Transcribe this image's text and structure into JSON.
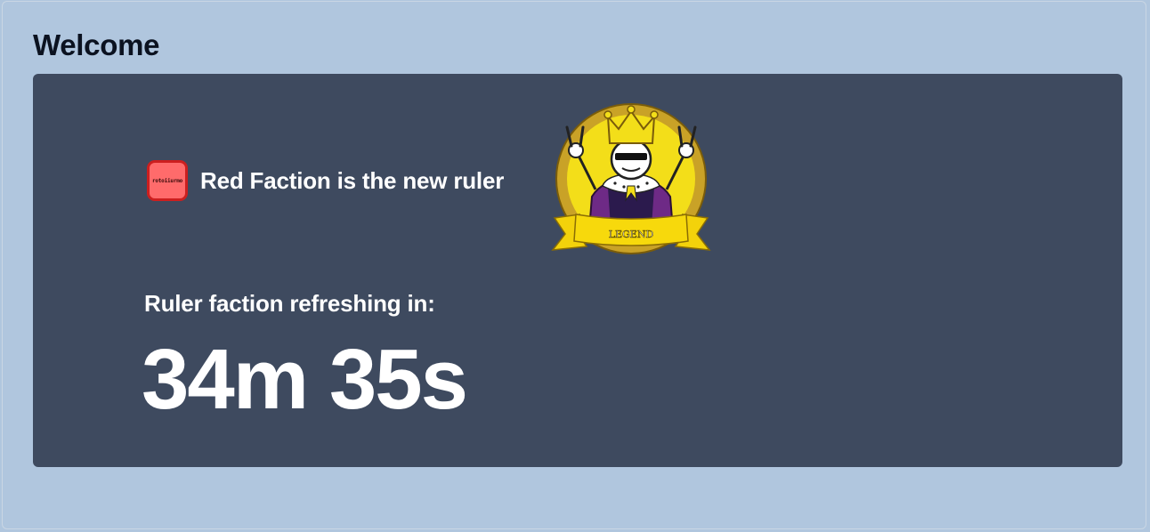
{
  "page": {
    "title": "Welcome"
  },
  "ruler": {
    "faction_badge_text": "rotoiiurmo",
    "announcement": "Red Faction is the new ruler",
    "faction_color": "#ff6b6b",
    "faction_border_color": "#cc1f1f",
    "badge_icon": "legend-king-icon",
    "badge_label": "LEGEND"
  },
  "refresh": {
    "label": "Ruler faction refreshing in:",
    "countdown": "34m 35s"
  },
  "colors": {
    "background": "#b0c6de",
    "panel": "#3e4a5f",
    "text_dark": "#0b1220",
    "text_light": "#ffffff"
  }
}
